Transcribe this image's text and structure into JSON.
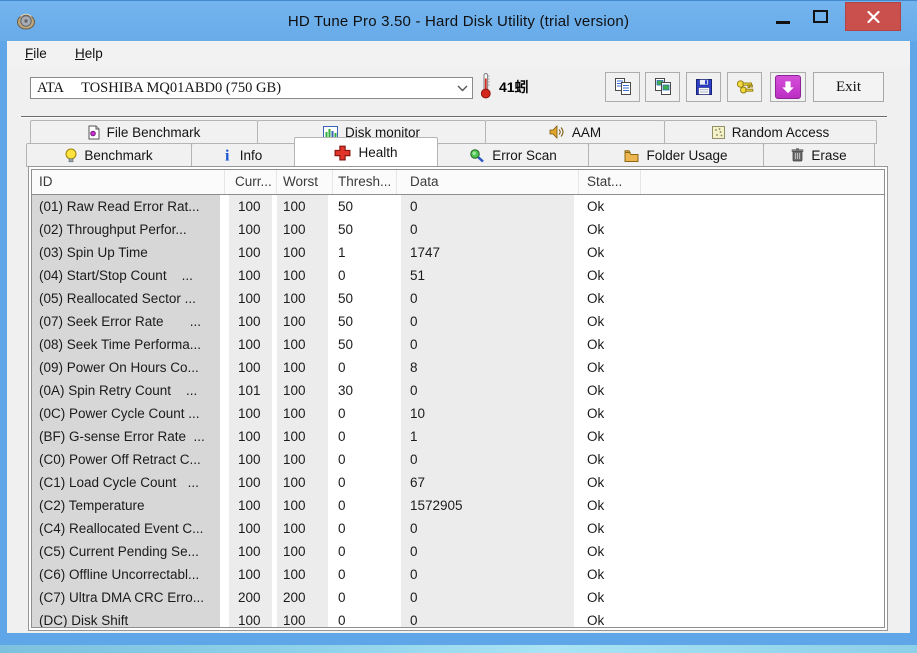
{
  "window": {
    "title": "HD Tune Pro 3.50 - Hard Disk Utility (trial version)",
    "app_icon": "hd-tune-app-icon",
    "controls": [
      {
        "name": "minimize",
        "icon": "minimize-icon"
      },
      {
        "name": "maximize",
        "icon": "maximize-icon"
      },
      {
        "name": "close",
        "icon": "close-icon"
      }
    ]
  },
  "menu": {
    "items": [
      {
        "label": "File"
      },
      {
        "label": "Help"
      }
    ]
  },
  "toolbar": {
    "device_selector": {
      "value": "ATA     TOSHIBA MQ01ABD0 (750 GB)",
      "icon": "chevron-down-icon"
    },
    "temperature_icon": "thermometer-icon",
    "temperature": "41蚓",
    "buttons": [
      {
        "icon": "copy-text-icon"
      },
      {
        "icon": "copy-image-icon"
      },
      {
        "icon": "save-icon"
      },
      {
        "icon": "keys-icon"
      },
      {
        "icon": "update-icon"
      }
    ],
    "exit_label": "Exit"
  },
  "tabs": {
    "row1": [
      {
        "label": "File Benchmark",
        "icon": "file-page-icon"
      },
      {
        "label": "Disk monitor",
        "icon": "bar-chart-icon"
      },
      {
        "label": "AAM",
        "icon": "speaker-icon"
      },
      {
        "label": "Random Access",
        "icon": "dotted-square-icon"
      }
    ],
    "row2": [
      {
        "label": "Benchmark",
        "icon": "lightbulb-icon"
      },
      {
        "label": "Info",
        "icon": "info-icon"
      },
      {
        "label": "Health",
        "icon": "red-cross-icon",
        "active": true
      },
      {
        "label": "Error Scan",
        "icon": "magnifier-icon"
      },
      {
        "label": "Folder Usage",
        "icon": "folder-icon"
      },
      {
        "label": "Erase",
        "icon": "trash-icon"
      }
    ]
  },
  "health_table": {
    "columns": [
      "ID",
      "Curr...",
      "Worst",
      "Thresh...",
      "Data",
      "Stat..."
    ],
    "rows": [
      {
        "id": "(01) Raw Read Error Rat...",
        "current": "100",
        "worst": "100",
        "threshold": "50",
        "data": "0",
        "status": "Ok"
      },
      {
        "id": "(02) Throughput Perfor...",
        "current": "100",
        "worst": "100",
        "threshold": "50",
        "data": "0",
        "status": "Ok"
      },
      {
        "id": "(03) Spin Up Time",
        "current": "100",
        "worst": "100",
        "threshold": "1",
        "data": "1747",
        "status": "Ok"
      },
      {
        "id": "(04) Start/Stop Count    ...",
        "current": "100",
        "worst": "100",
        "threshold": "0",
        "data": "51",
        "status": "Ok"
      },
      {
        "id": "(05) Reallocated Sector ...",
        "current": "100",
        "worst": "100",
        "threshold": "50",
        "data": "0",
        "status": "Ok"
      },
      {
        "id": "(07) Seek Error Rate       ...",
        "current": "100",
        "worst": "100",
        "threshold": "50",
        "data": "0",
        "status": "Ok"
      },
      {
        "id": "(08) Seek Time Performa...",
        "current": "100",
        "worst": "100",
        "threshold": "50",
        "data": "0",
        "status": "Ok"
      },
      {
        "id": "(09) Power On Hours Co...",
        "current": "100",
        "worst": "100",
        "threshold": "0",
        "data": "8",
        "status": "Ok"
      },
      {
        "id": "(0A) Spin Retry Count    ...",
        "current": "101",
        "worst": "100",
        "threshold": "30",
        "data": "0",
        "status": "Ok"
      },
      {
        "id": "(0C) Power Cycle Count ...",
        "current": "100",
        "worst": "100",
        "threshold": "0",
        "data": "10",
        "status": "Ok"
      },
      {
        "id": "(BF) G-sense Error Rate  ...",
        "current": "100",
        "worst": "100",
        "threshold": "0",
        "data": "1",
        "status": "Ok"
      },
      {
        "id": "(C0) Power Off Retract C...",
        "current": "100",
        "worst": "100",
        "threshold": "0",
        "data": "0",
        "status": "Ok"
      },
      {
        "id": "(C1) Load Cycle Count   ...",
        "current": "100",
        "worst": "100",
        "threshold": "0",
        "data": "67",
        "status": "Ok"
      },
      {
        "id": "(C2) Temperature",
        "current": "100",
        "worst": "100",
        "threshold": "0",
        "data": "1572905",
        "status": "Ok"
      },
      {
        "id": "(C4) Reallocated Event C...",
        "current": "100",
        "worst": "100",
        "threshold": "0",
        "data": "0",
        "status": "Ok"
      },
      {
        "id": "(C5) Current Pending Se...",
        "current": "100",
        "worst": "100",
        "threshold": "0",
        "data": "0",
        "status": "Ok"
      },
      {
        "id": "(C6) Offline Uncorrectabl...",
        "current": "100",
        "worst": "100",
        "threshold": "0",
        "data": "0",
        "status": "Ok"
      },
      {
        "id": "(C7) Ultra DMA CRC Erro...",
        "current": "200",
        "worst": "200",
        "threshold": "0",
        "data": "0",
        "status": "Ok"
      },
      {
        "id": "(DC) Disk Shift",
        "current": "100",
        "worst": "100",
        "threshold": "0",
        "data": "0",
        "status": "Ok"
      }
    ]
  },
  "colors": {
    "titlebar": "#6caeea",
    "frame": "#5fa6e8",
    "close_button": "#c9504c",
    "client_bg": "#f0f0f0",
    "id_column_bg": "#d7d7d7",
    "column_band_bg": "#ececec",
    "update_button": "#c43fce",
    "health_cross": "#e03428"
  }
}
